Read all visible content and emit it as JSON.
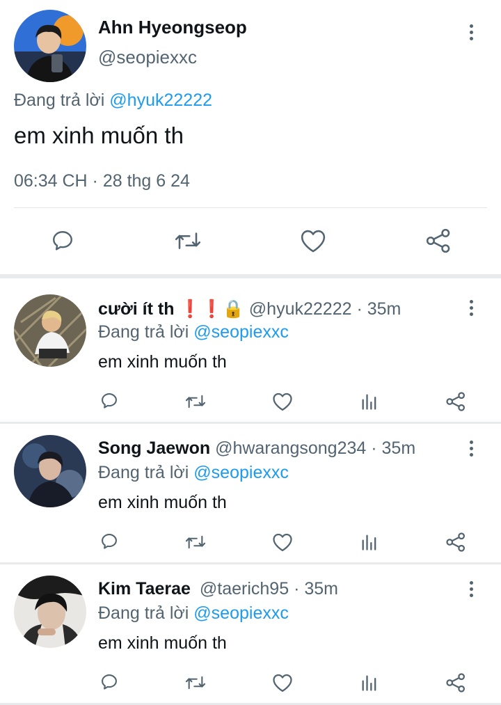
{
  "main_tweet": {
    "display_name": "Ahn Hyeongseop",
    "handle": "@seopiexxc",
    "reply_prefix": "Đang trả lời",
    "reply_to": "@hyuk22222",
    "text": "em xinh muốn th",
    "timestamp": "06:34 CH · 28 thg 6 24",
    "actions": [
      "reply-icon",
      "retweet-icon",
      "like-icon",
      "share-icon"
    ]
  },
  "replies": [
    {
      "display_name": "cười ít th",
      "emojis": "❗❗🔒",
      "handle": "@hyuk22222",
      "time": "· 35m",
      "reply_prefix": "Đang trả lời",
      "reply_to": "@seopiexxc",
      "text": "em xinh muốn th"
    },
    {
      "display_name": "Song Jaewon",
      "handle": "@hwarangsong234",
      "time": "· 35m",
      "reply_prefix": "Đang trả lời",
      "reply_to": "@seopiexxc",
      "text": "em xinh muốn th"
    },
    {
      "display_name": "Kim Taerae",
      "handle": "@taerich95",
      "time": "· 35m",
      "reply_prefix": "Đang trả lời",
      "reply_to": "@seopiexxc",
      "text": "em xinh muốn th"
    }
  ],
  "colors": {
    "accent": "#1d9bf0",
    "secondary_text": "#536471",
    "divider": "#e8eaec"
  }
}
